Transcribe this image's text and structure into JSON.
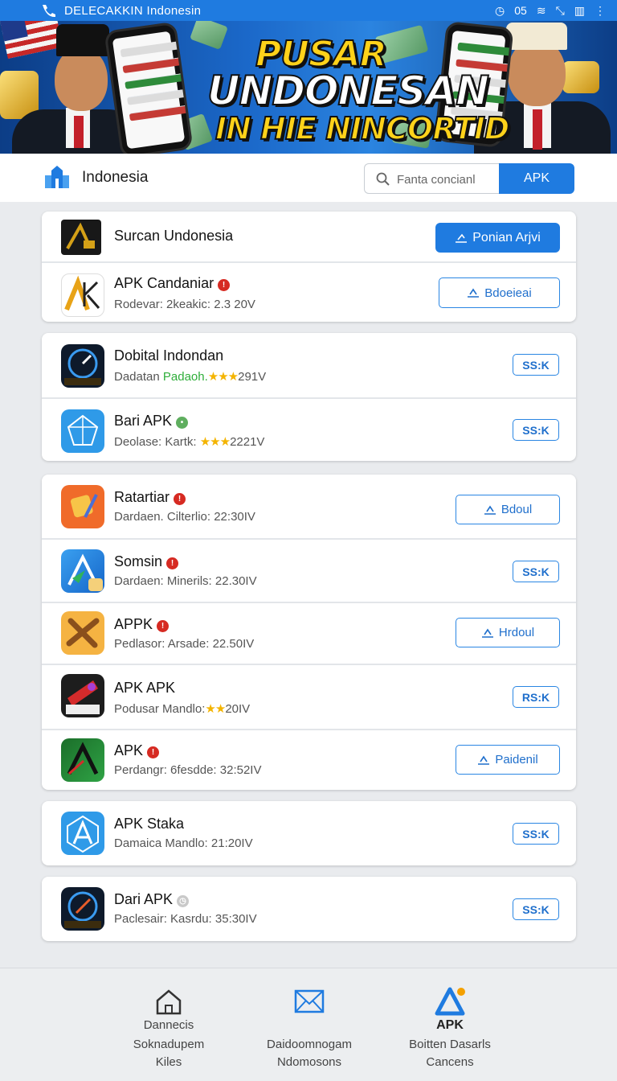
{
  "status_bar": {
    "title": "DELECAKKIN Indonesin",
    "indicators": [
      "◷",
      "05",
      "≋",
      "⤡",
      "▥",
      "⋮"
    ]
  },
  "banner": {
    "headline_1": "PUSAR",
    "headline_2": "UNDONESAN",
    "headline_3": "IN HIE NINCORTID"
  },
  "header": {
    "brand": "Indonesia",
    "search_placeholder": "Fanta concianl",
    "search_button": "APK"
  },
  "cards": [
    {
      "rows": [
        {
          "title": "Surcan Undonesia",
          "button": "Ponian Arjvi",
          "button_style": "filled"
        },
        {
          "title": "APK Candaniar",
          "badge": "!",
          "subtitle": "Rodevar: 2keakic: 2.3 20V",
          "button": "Bdoeieai",
          "button_style": "outline"
        }
      ]
    },
    {
      "rows": [
        {
          "title": "Dobital Indondan",
          "subtitle_prefix": "Dadatan ",
          "subtitle_green": "Padaoh.",
          "subtitle_stars": "★★★",
          "subtitle_suffix": "291V",
          "button": "SS:K",
          "button_style": "small"
        },
        {
          "title": "Bari APK",
          "badge": "•",
          "badge_color": "green",
          "subtitle_prefix": "Deolase: Kartk: ",
          "subtitle_stars": "★★★",
          "subtitle_suffix": "2221V",
          "button": "SS:K",
          "button_style": "small"
        }
      ]
    },
    {
      "rows": [
        {
          "title": "Ratartiar",
          "badge": "!",
          "subtitle": "Dardaen. Cilterlio: 22:30IV",
          "button": "Bdoul",
          "button_style": "outline"
        },
        {
          "title": "Somsin",
          "badge": "!",
          "subtitle": "Dardaen: Minerils: 22.30IV",
          "button": "SS:K",
          "button_style": "small"
        },
        {
          "title": "APPK",
          "badge": "!",
          "subtitle": "Pedlasor: Arsade: 22.50IV",
          "button": "Hrdoul",
          "button_style": "outline"
        },
        {
          "title": "APK APK",
          "subtitle_prefix": "Podusar Mandlo:",
          "subtitle_stars": "★★",
          "subtitle_suffix": "20IV",
          "button": "RS:K",
          "button_style": "small"
        },
        {
          "title": "APK",
          "badge": "!",
          "subtitle": "Perdangr: 6fesdde: 32:52IV",
          "button": "Paidenil",
          "button_style": "outline"
        }
      ]
    },
    {
      "rows": [
        {
          "title": "APK Staka",
          "subtitle": "Damaica Mandlo: 21:20IV",
          "button": "SS:K",
          "button_style": "small"
        }
      ]
    },
    {
      "rows": [
        {
          "title": "Dari APK",
          "badge": "◷",
          "badge_color": "grey",
          "subtitle": "Paclesair: Kasrdu: 35:30IV",
          "button": "SS:K",
          "button_style": "small"
        }
      ]
    }
  ],
  "bottom_nav": [
    {
      "icon": "home-icon",
      "line1": "Dannecis",
      "line2": "Soknadupem",
      "line3": "Kiles"
    },
    {
      "icon": "mail-icon",
      "line1": "",
      "line2": "Daidoomnogam",
      "line3": "Ndomosons"
    },
    {
      "icon": "apk-logo-icon",
      "line1": "APK",
      "line2": "Boitten Dasarls",
      "line3": "Cancens"
    }
  ],
  "colors": {
    "accent": "#1f7be0",
    "badge_red": "#d62a22",
    "star": "#f4b400"
  }
}
